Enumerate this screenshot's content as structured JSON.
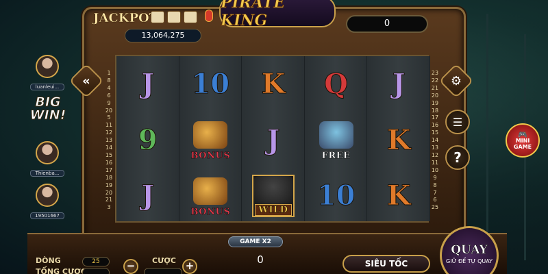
{
  "header": {
    "game_title": "PIRATE KING",
    "jackpot_label": "JACKPOT",
    "jackpot_value": "13,064,275",
    "win_display": "0"
  },
  "sidebar_left": {
    "winners": [
      {
        "name": "luanleui..."
      },
      {
        "name": "Thienba..."
      },
      {
        "name": "19501667"
      }
    ],
    "big_win_line1": "BIG",
    "big_win_line2": "WIN!"
  },
  "reels": {
    "rows": [
      [
        {
          "type": "text",
          "value": "J",
          "style": "J"
        },
        {
          "type": "text",
          "value": "10",
          "style": "T"
        },
        {
          "type": "text",
          "value": "K",
          "style": "K"
        },
        {
          "type": "text",
          "value": "Q",
          "style": "Q"
        },
        {
          "type": "text",
          "value": "J",
          "style": "J"
        }
      ],
      [
        {
          "type": "text",
          "value": "9",
          "style": "N"
        },
        {
          "type": "badge",
          "value": "BONUS",
          "style": "bonus"
        },
        {
          "type": "text",
          "value": "J",
          "style": "J"
        },
        {
          "type": "badge",
          "value": "FREE",
          "style": "free"
        },
        {
          "type": "text",
          "value": "K",
          "style": "K"
        }
      ],
      [
        {
          "type": "text",
          "value": "J",
          "style": "J"
        },
        {
          "type": "badge",
          "value": "BONUS",
          "style": "bonus"
        },
        {
          "type": "badge",
          "value": "WILD",
          "style": "wild"
        },
        {
          "type": "text",
          "value": "10",
          "style": "T"
        },
        {
          "type": "text",
          "value": "K",
          "style": "K"
        }
      ]
    ]
  },
  "line_numbers": {
    "left": [
      "1",
      "8",
      "4",
      "6",
      "9",
      "20",
      "5",
      "11",
      "12",
      "13",
      "14",
      "15",
      "16",
      "17",
      "18",
      "19",
      "20",
      "21",
      "3"
    ],
    "right": [
      "23",
      "22",
      "21",
      "20",
      "19",
      "18",
      "17",
      "16",
      "15",
      "14",
      "13",
      "12",
      "11",
      "10",
      "9",
      "8",
      "7",
      "6",
      "25"
    ]
  },
  "side_buttons": {
    "mini_game_line1": "MINI",
    "mini_game_line2": "GAME",
    "help_label": "?"
  },
  "bottom_bar": {
    "game_mode": "GAME X2",
    "center_value": "0",
    "lines_label": "DÒNG",
    "lines_value": "25",
    "total_bet_label": "TỔNG CƯỢC",
    "bet_label": "CƯỢC",
    "minus": "−",
    "plus": "+",
    "turbo_label": "SIÊU TỐC",
    "spin_label": "QUAY",
    "spin_sub": "GIỮ ĐỂ TỰ QUAY"
  }
}
